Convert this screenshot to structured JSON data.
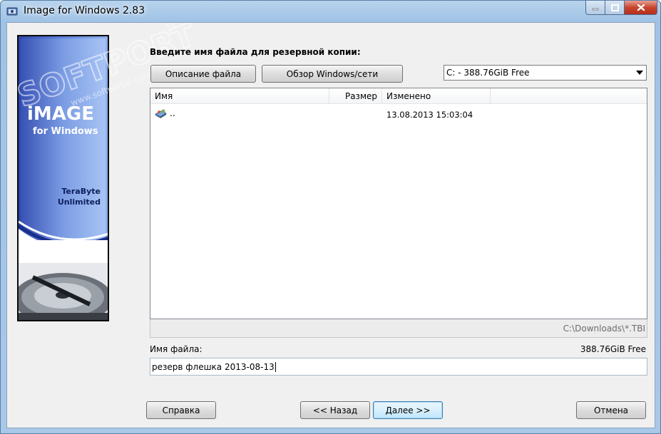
{
  "window": {
    "title": "Image for Windows 2.83"
  },
  "banner": {
    "logo_line1": "iMAGE",
    "logo_line2": "for Windows",
    "vendor_line1": "TeraByte",
    "vendor_line2": "Unlimited",
    "watermark": "SOFTPORTAL",
    "watermark_url": "www.softportal.com",
    "watermark_tm": "TM"
  },
  "main": {
    "prompt": "Введите имя файла для резервной копии:",
    "describe_button": "Описание файла",
    "browse_button": "Обзор Windows/сети",
    "drive_selected": "C: - 388.76GiB Free",
    "columns": [
      "Имя",
      "Размер",
      "Изменено"
    ],
    "rows": [
      {
        "name": "..",
        "size": "",
        "modified": "13.08.2013 15:03:04"
      }
    ],
    "path": "C:\\Downloads\\*.TBI",
    "filename_label": "Имя файла:",
    "free_space": "388.76GiB Free",
    "filename_value": "резерв флешка 2013-08-13"
  },
  "footer": {
    "help_button": "Справка",
    "back_button": "<< Назад",
    "next_button": "Далее >>",
    "cancel_button": "Отмена"
  },
  "colors": {
    "titlebar": "#a9c8e8",
    "close_button": "#c7452f",
    "banner_blue": "#3852b5"
  }
}
